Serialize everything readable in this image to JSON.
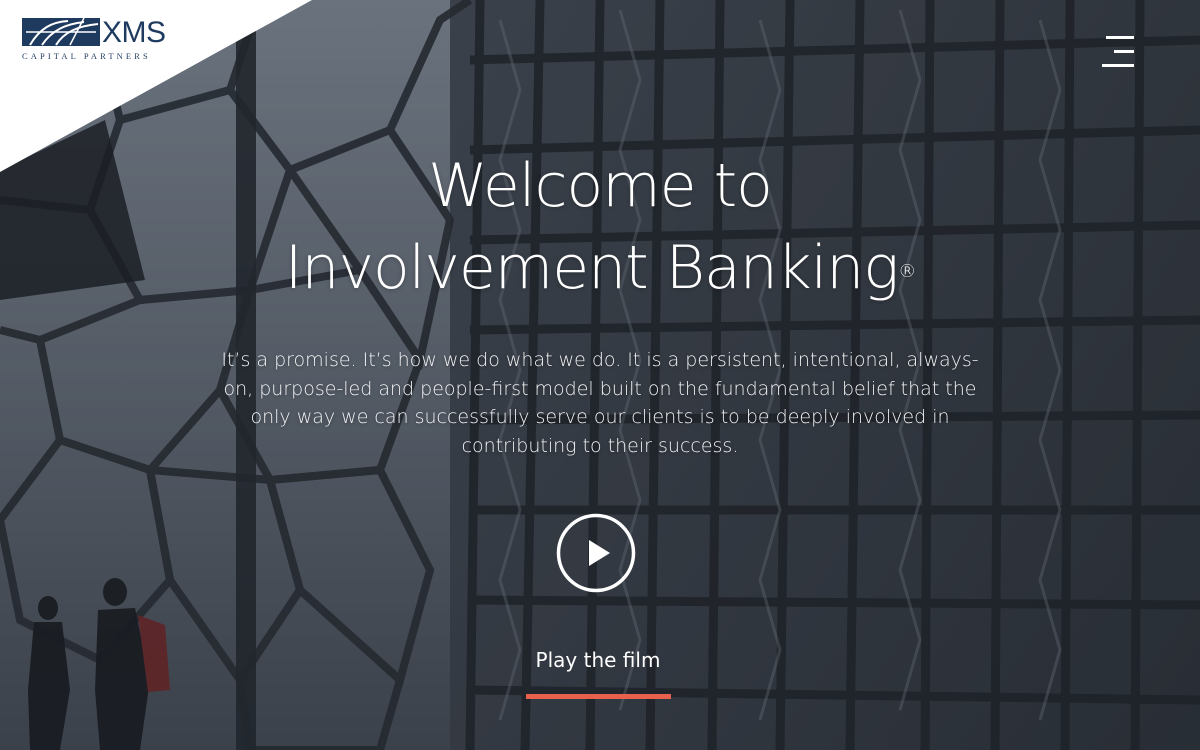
{
  "brand": {
    "logo_word": "XMS",
    "logo_sub": "CAPITAL PARTNERS",
    "color": "#1f3a5f"
  },
  "nav": {
    "menu_icon": "hamburger-menu-icon"
  },
  "hero": {
    "title_line1": "Welcome to",
    "title_line2": "Involvement Banking",
    "title_mark": "®",
    "intro": "It’s a promise. It’s how we do what we do. It is a persistent, intentional, always-on, purpose-led and people-first model built on the fundamental belief that the only way we can successfully serve our clients is to be deeply involved in contributing to their success.",
    "play_icon": "play-circle-icon",
    "play_label": "Play the film",
    "accent_color": "#e8614d"
  }
}
